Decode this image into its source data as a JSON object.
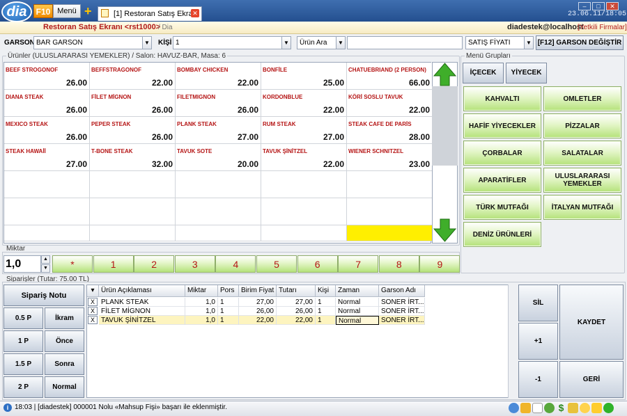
{
  "window": {
    "logo_text": "dia",
    "f10_label": "F10",
    "menu_label": "Menü",
    "plus_label": "+",
    "tab_title": "[1] Restoran Satış Ekranı",
    "clock": "23.06.11/18:05"
  },
  "header": {
    "title": "Restoran Satış Ekranı <rst1000>",
    "subtitle": "/ Dia",
    "user": "diadestek@localhost",
    "role": "[Yetkili Firmalar]"
  },
  "toolbar": {
    "garson_label": "GARSON",
    "garson_value": "BAR GARSON",
    "kisi_label": "KİŞİ",
    "kisi_value": "1",
    "search_mode": "Ürün Ara",
    "search_value": "",
    "price_type": "SATIŞ FİYATI",
    "change_waiter_button": "[F12] GARSON DEĞİŞTİR"
  },
  "products": {
    "title": "Ürünler (ULUSLARARASI YEMEKLER)  / Salon: HAVUZ-BAR, Masa: 6",
    "items": [
      {
        "name": "BEEF STROGONOF",
        "price": "26.00"
      },
      {
        "name": "BEFFSTRAGONOF",
        "price": "22.00"
      },
      {
        "name": "BOMBAY CHICKEN",
        "price": "22.00"
      },
      {
        "name": "BONFİLE",
        "price": "25.00"
      },
      {
        "name": "CHATUEBRIAND (2 PERSON)",
        "price": "66.00"
      },
      {
        "name": "DIANA STEAK",
        "price": "26.00"
      },
      {
        "name": "FİLET MİGNON",
        "price": "26.00"
      },
      {
        "name": "FILETMIGNON",
        "price": "26.00"
      },
      {
        "name": "KORDONBLUE",
        "price": "22.00"
      },
      {
        "name": "KÖRİ SOSLU TAVUK",
        "price": "22.00"
      },
      {
        "name": "MEXICO STEAK",
        "price": "26.00"
      },
      {
        "name": "PEPER STEAK",
        "price": "26.00"
      },
      {
        "name": "PLANK STEAK",
        "price": "27.00"
      },
      {
        "name": "RUM STEAK",
        "price": "27.00"
      },
      {
        "name": "STEAK CAFE DE PARİS",
        "price": "28.00"
      },
      {
        "name": "STEAK HAWAİİ",
        "price": "27.00"
      },
      {
        "name": "T-BONE STEAK",
        "price": "32.00"
      },
      {
        "name": "TAVUK SOTE",
        "price": "20.00"
      },
      {
        "name": "TAVUK ŞİNİTZEL",
        "price": "22.00"
      },
      {
        "name": "WIENER SCHNITZEL",
        "price": "23.00"
      }
    ],
    "highlight_color": "#ffef00"
  },
  "menu_groups": {
    "title": "Menü Grupları",
    "top_buttons": [
      "İÇECEK",
      "YİYECEK"
    ],
    "items": [
      "KAHVALTI",
      "OMLETLER",
      "HAFİF YİYECEKLER",
      "PİZZALAR",
      "ÇORBALAR",
      "SALATALAR",
      "APARATİFLER",
      "ULUSLARARASI YEMEKLER",
      "TÜRK MUTFAĞI",
      "İTALYAN MUTFAĞI",
      "DENİZ ÜRÜNLERİ"
    ]
  },
  "quantity": {
    "title": "Miktar",
    "value": "1,0",
    "keys": [
      "*",
      "1",
      "2",
      "3",
      "4",
      "5",
      "6",
      "7",
      "8",
      "9"
    ]
  },
  "orders": {
    "title": "Siparişler (Tutar: 75.00 TL)",
    "left_buttons": {
      "note": "Sipariş Notu",
      "p05": "0.5 P",
      "ikram": "İkram",
      "p1": "1 P",
      "once": "Önce",
      "p15": "1.5 P",
      "sonra": "Sonra",
      "p2": "2 P",
      "normal": "Normal"
    },
    "columns": [
      "Ürün Açıklaması",
      "Miktar",
      "Pors",
      "Birim Fiyat",
      "Tutarı",
      "Kişi",
      "Zaman",
      "Garson Adı"
    ],
    "rows": [
      {
        "x": "X",
        "name": "PLANK STEAK",
        "qty": "1,0",
        "pors": "1",
        "unit": "27,00",
        "total": "27,00",
        "kisi": "1",
        "zaman": "Normal",
        "garson": "SONER İRT..."
      },
      {
        "x": "X",
        "name": "FİLET MİGNON",
        "qty": "1,0",
        "pors": "1",
        "unit": "26,00",
        "total": "26,00",
        "kisi": "1",
        "zaman": "Normal",
        "garson": "SONER İRT..."
      },
      {
        "x": "X",
        "name": "TAVUK ŞİNİTZEL",
        "qty": "1,0",
        "pors": "1",
        "unit": "22,00",
        "total": "22,00",
        "kisi": "1",
        "zaman": "Normal",
        "garson": "SONER İRT..."
      }
    ],
    "right_buttons": {
      "sil": "SİL",
      "plus1": "+1",
      "minus1": "-1",
      "kaydet": "KAYDET",
      "geri": "GERİ"
    }
  },
  "status": {
    "text": "18:03 | [diadestek] 000001 Nolu «Mahsup Fişi» başarı ile eklenmiştir."
  }
}
